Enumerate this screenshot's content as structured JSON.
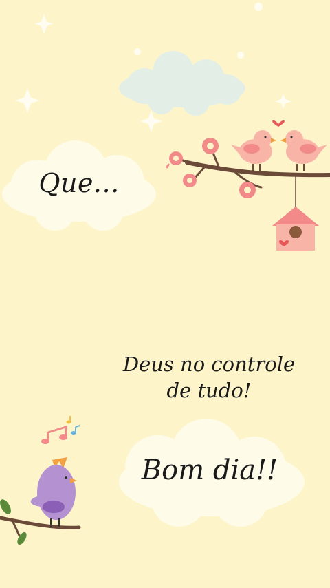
{
  "greeting": {
    "intro_text": "Que...",
    "message_line1": "Deus no controle",
    "message_line2": "de tudo!",
    "closing_text": "Bom dia!!"
  },
  "colors": {
    "background": "#fdf5c9",
    "cloud": "#fffbe9",
    "blue_cloud": "#e3efe6",
    "pink": "#f28a8a",
    "purple": "#b491d1",
    "branch": "#6b4a3a"
  },
  "icons": [
    "star-icon",
    "cloud-icon",
    "love-birds-icon",
    "flower-icon",
    "birdhouse-icon",
    "heart-icon",
    "music-notes-icon",
    "purple-bird-icon",
    "branch-icon",
    "leaf-icon"
  ]
}
